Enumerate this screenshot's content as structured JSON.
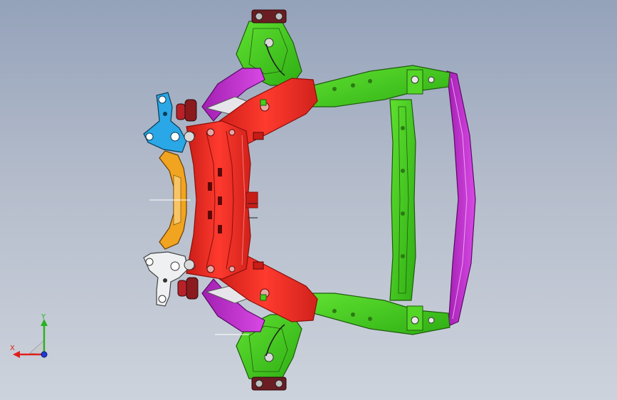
{
  "viewport": {
    "background_top": "#94a2ba",
    "background_bottom": "#cdd3dc"
  },
  "colors": {
    "subframe": "#ee2b24",
    "subframe_dark": "#8a0f0c",
    "control_arm": "#44d01c",
    "control_arm_dark": "#1f5a0e",
    "link": "#c934d6",
    "bracket_blue": "#2aa7e6",
    "bracket_orange": "#f0a41f",
    "bracket_white": "#eef0f2",
    "bushing": "#7a1214",
    "bolt": "#5b6068",
    "wire": "#202020"
  },
  "triad": {
    "x_label": "X",
    "y_label": "Y",
    "x_color": "#e0201a",
    "y_color": "#27b21f",
    "z_color": "#1e3bd6"
  }
}
